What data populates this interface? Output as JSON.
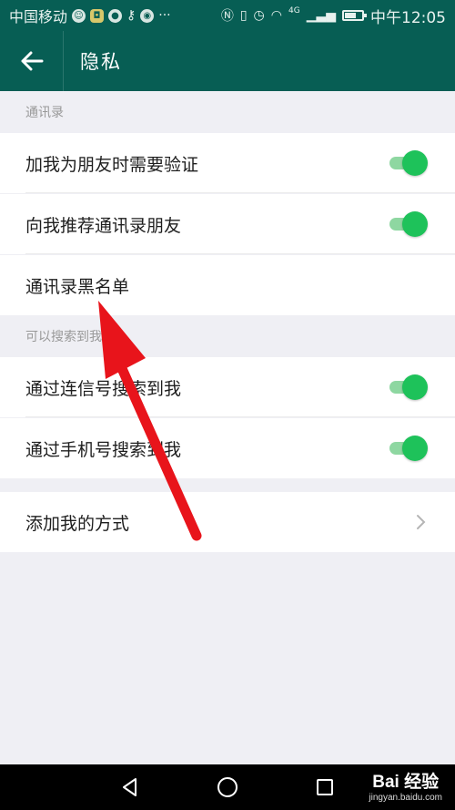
{
  "status_bar": {
    "carrier": "中国移动",
    "network_label": "4G",
    "time": "中午12:05"
  },
  "header": {
    "title": "隐私"
  },
  "sections": [
    {
      "header": "通讯录",
      "rows": [
        {
          "label": "加我为朋友时需要验证",
          "control": "toggle",
          "on": true
        },
        {
          "label": "向我推荐通讯录朋友",
          "control": "toggle",
          "on": true
        },
        {
          "label": "通讯录黑名单",
          "control": "none"
        }
      ]
    },
    {
      "header": "可以搜索到我",
      "rows": [
        {
          "label": "通过连信号搜索到我",
          "control": "toggle",
          "on": true
        },
        {
          "label": "通过手机号搜索到我",
          "control": "toggle",
          "on": true
        }
      ]
    },
    {
      "header": "",
      "rows": [
        {
          "label": "添加我的方式",
          "control": "chevron"
        }
      ]
    }
  ],
  "watermark": {
    "logo": "Bai 经验",
    "url": "jingyan.baidu.com"
  },
  "colors": {
    "brand": "#075e54",
    "toggle_on": "#1ec25a",
    "annotation_arrow": "#e8141b"
  },
  "icons": [
    "back-arrow-icon",
    "chevron-right-icon",
    "nav-back-icon",
    "nav-home-icon",
    "nav-recents-icon"
  ]
}
